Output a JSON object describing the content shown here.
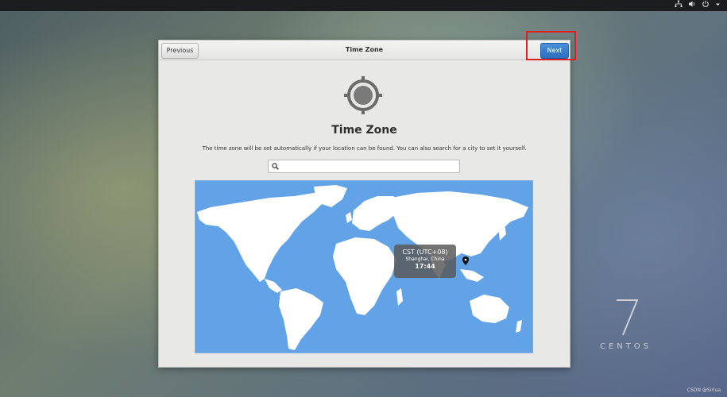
{
  "header": {
    "previous_label": "Previous",
    "title": "Time Zone",
    "next_label": "Next"
  },
  "main": {
    "heading": "Time Zone",
    "description": "The time zone will be set automatically if your location can be found. You can also search for a city to set it yourself.",
    "search": {
      "value": "",
      "placeholder": ""
    }
  },
  "tooltip": {
    "zone": "CST (UTC+08)",
    "city": "Shanghai, China",
    "time": "17:44"
  },
  "branding": {
    "version": "7",
    "name": "CENTOS"
  },
  "watermark": "CSDN @Sirlua",
  "colors": {
    "map_ocean": "#62a2e6",
    "land": "#ffffff",
    "next_button": "#3b82d0",
    "highlight": "#e02020"
  }
}
